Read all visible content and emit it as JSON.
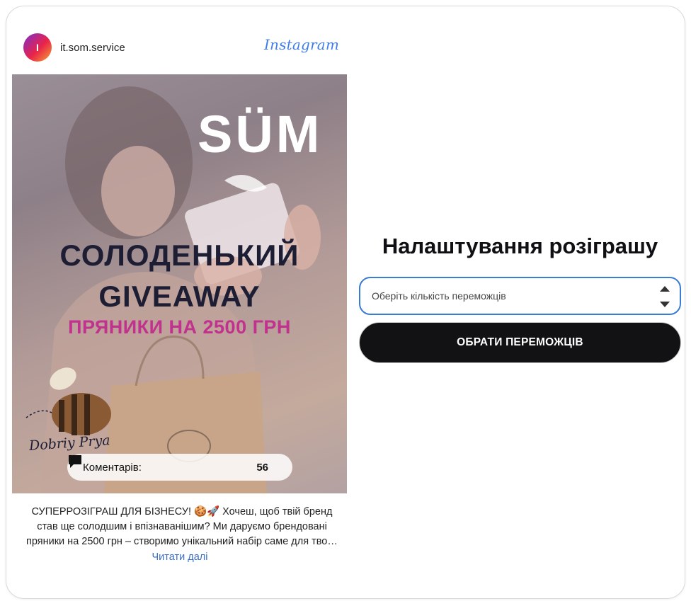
{
  "post": {
    "account": {
      "avatar_letter": "I",
      "name": "it.som.service",
      "platform": "Instagram"
    },
    "image": {
      "logo_text": "SÜM",
      "headline_line1": "СОЛОДЕНЬКИЙ",
      "headline_line2": "GIVEAWAY",
      "headline_line3": "ПРЯНИКИ НА 2500 ГРН",
      "signature": "Dobriy Prya",
      "comments_label": "Коментарів:",
      "comments_count": "56"
    },
    "caption": {
      "line1": "СУПЕРРОЗІГРАШ ДЛЯ БІЗНЕСУ! 🍪🚀 Хочеш, щоб твій бренд",
      "line2": "став ще солодшим і впізнаванішим? Ми даруємо брендовані",
      "line3": "пряники на 2500 грн – створимо унікальний набір саме для твог…",
      "read_more": "Читати далі"
    }
  },
  "settings": {
    "title": "Налаштування розіграшу",
    "winners_select": {
      "placeholder": "Оберіть кількість переможців"
    },
    "pick_button": "ОБРАТИ ПЕРЕМОЖЦІВ"
  },
  "colors": {
    "accent_blue": "#3a7bd5",
    "button_dark": "#121214",
    "headline_pink": "#c0328e",
    "headline_navy": "#1d1e34"
  },
  "icons": {
    "comment": "speech-bubble-icon",
    "spinner": "up-down-arrows-icon"
  }
}
